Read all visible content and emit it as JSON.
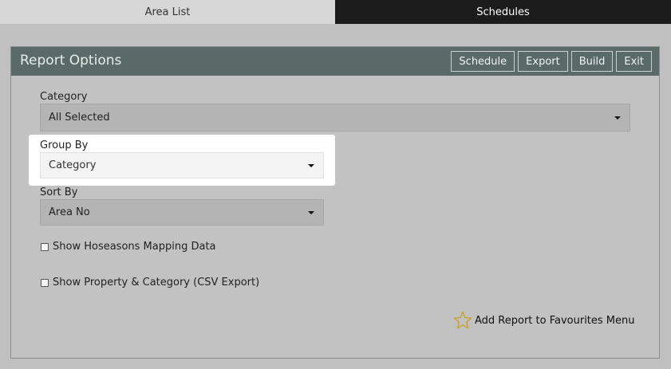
{
  "tabs": [
    {
      "label": "Area List"
    },
    {
      "label": "Schedules"
    }
  ],
  "panel": {
    "title": "Report Options",
    "buttons": {
      "schedule": "Schedule",
      "export": "Export",
      "build": "Build",
      "exit": "Exit"
    }
  },
  "fields": {
    "category": {
      "label": "Category",
      "value": "All Selected"
    },
    "group_by": {
      "label": "Group By",
      "value": "Category"
    },
    "sort_by": {
      "label": "Sort By",
      "value": "Area No"
    }
  },
  "checkboxes": {
    "hoseasons": {
      "label": "Show Hoseasons Mapping Data",
      "checked": false
    },
    "property_category": {
      "label": "Show Property & Category (CSV Export)",
      "checked": false
    }
  },
  "favourites": {
    "label": "Add Report to Favourites Menu",
    "icon": "star-icon",
    "icon_color": "#c9a227"
  },
  "colors": {
    "header_bg": "#5a6b67",
    "active_tab_bg": "#1c1c1c"
  }
}
